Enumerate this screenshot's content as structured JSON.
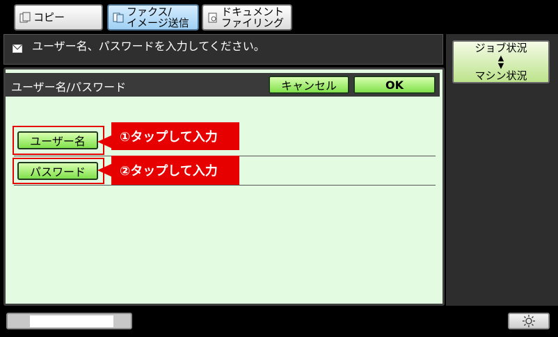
{
  "tabs": [
    {
      "label": "コピー"
    },
    {
      "line1": "ファクス/",
      "line2": "イメージ送信"
    },
    {
      "line1": "ドキュメント",
      "line2": "ファイリング"
    }
  ],
  "message": "ユーザー名、パスワードを入力してください。",
  "job_button": {
    "line1": "ジョブ状況",
    "line2": "マシン状況"
  },
  "dialog": {
    "title": "ユーザー名/パスワード",
    "cancel": "キャンセル",
    "ok": "OK",
    "user_button": "ユーザー名",
    "password_button": "パスワード"
  },
  "callouts": {
    "step1": "①タップして入力",
    "step2": "②タップして入力"
  },
  "icons": [
    "copy-icon",
    "fax-icon",
    "document-icon",
    "mail-icon",
    "brightness-icon"
  ],
  "colors": {
    "accent_green": "#7fe04a",
    "callout_red": "#e60000",
    "dialog_bg": "#e3fbe1"
  }
}
